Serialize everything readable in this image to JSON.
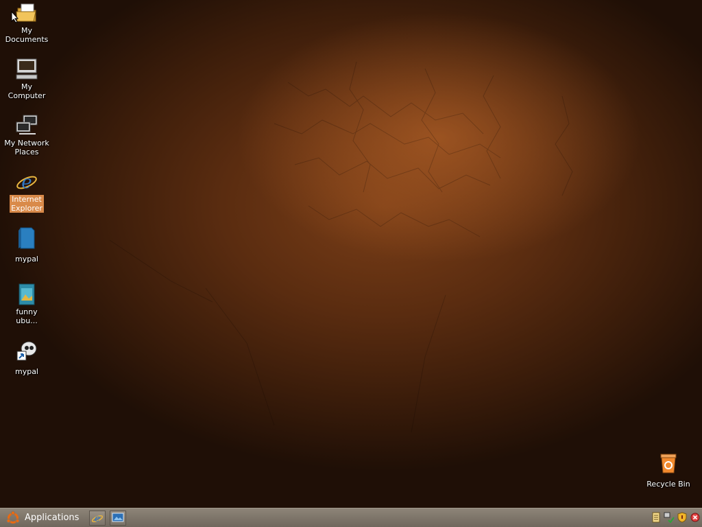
{
  "desktop": {
    "icons": [
      {
        "label": "My\nDocuments",
        "icon": "folder-open-icon"
      },
      {
        "label": "My\nComputer",
        "icon": "computer-icon"
      },
      {
        "label": "My Network\nPlaces",
        "icon": "network-places-icon"
      },
      {
        "label": "Internet\nExplorer",
        "icon": "internet-explorer-icon",
        "selected": true
      },
      {
        "label": "mypal",
        "icon": "blue-file-icon"
      },
      {
        "label": "funny\nubu...",
        "icon": "image-file-icon"
      },
      {
        "label": "mypal",
        "icon": "mypal-shortcut-icon"
      }
    ],
    "recycle_bin": {
      "label": "Recycle Bin",
      "icon": "recycle-bin-icon"
    }
  },
  "taskbar": {
    "start_label": "Applications",
    "quick_launch": [
      "internet-explorer-icon",
      "show-desktop-icon"
    ],
    "tray": [
      "notes-icon",
      "network-status-icon",
      "security-shield-icon",
      "close-alert-icon"
    ]
  },
  "colors": {
    "selection": "#d98a4a",
    "taskbar": "#7d756a",
    "wallpaper_center": "#7a3e17"
  }
}
